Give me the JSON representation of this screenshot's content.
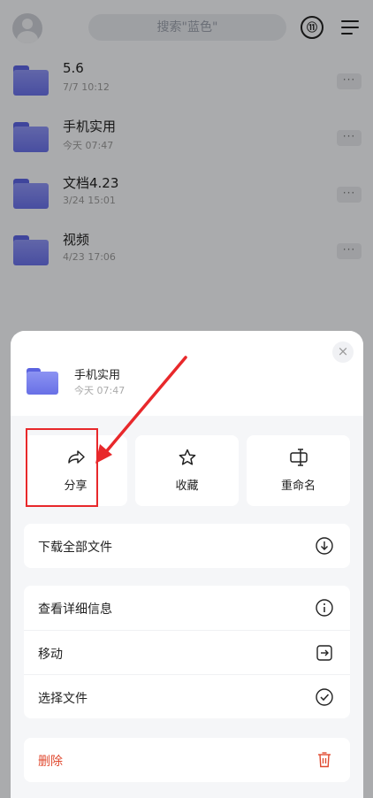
{
  "header": {
    "search_placeholder": "搜索\"蓝色\"",
    "sort_icon_text": "⑪"
  },
  "files": [
    {
      "name": "5.6",
      "date": "7/7 10:12",
      "more": "···"
    },
    {
      "name": "手机实用",
      "date": "今天 07:47",
      "more": "···"
    },
    {
      "name": "文档4.23",
      "date": "3/24 15:01",
      "more": "···"
    },
    {
      "name": "视频",
      "date": "4/23 17:06",
      "more": "···"
    }
  ],
  "sheet": {
    "file_name": "手机实用",
    "file_date": "今天 07:47",
    "close": "×",
    "actions": [
      {
        "label": "分享",
        "icon": "share-icon"
      },
      {
        "label": "收藏",
        "icon": "star-icon"
      },
      {
        "label": "重命名",
        "icon": "rename-icon"
      }
    ],
    "download_all": "下载全部文件",
    "details": "查看详细信息",
    "move": "移动",
    "select_files": "选择文件",
    "delete": "删除"
  },
  "colors": {
    "accent_red": "#e8282b",
    "folder_blue": "#6870e6",
    "delete_red": "#e0492f"
  }
}
